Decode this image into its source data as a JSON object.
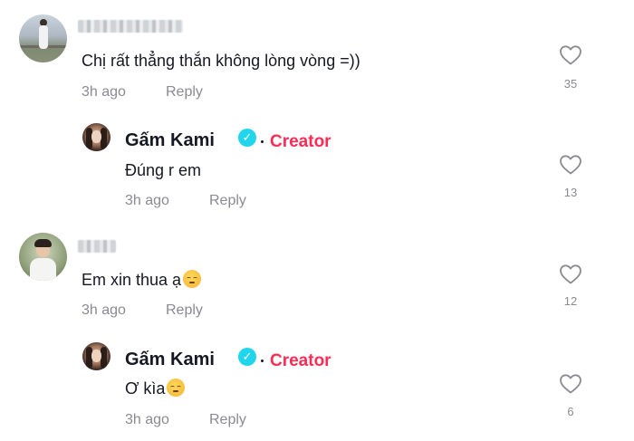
{
  "comments": [
    {
      "text": "Chị rất thẳng thắn không lòng vòng =))",
      "time": "3h ago",
      "reply": "Reply",
      "likes": "35",
      "replies": [
        {
          "author": "Gấm Kami",
          "badge": "Creator",
          "text": "Đúng r em",
          "time": "3h ago",
          "reply": "Reply",
          "likes": "13"
        }
      ]
    },
    {
      "text": "Em xin thua ạ",
      "emoji": "pensive-face",
      "time": "3h ago",
      "reply": "Reply",
      "likes": "12",
      "replies": [
        {
          "author": "Gấm Kami",
          "badge": "Creator",
          "text": "Ơ kìa",
          "emoji": "pensive-face",
          "time": "3h ago",
          "reply": "Reply",
          "likes": "6"
        }
      ]
    }
  ],
  "colors": {
    "creator_badge": "#fe2c55",
    "verified": "#20d5ec",
    "meta_text": "#8a8b91"
  },
  "icons": [
    "heart-outline-icon",
    "verified-check-icon"
  ]
}
